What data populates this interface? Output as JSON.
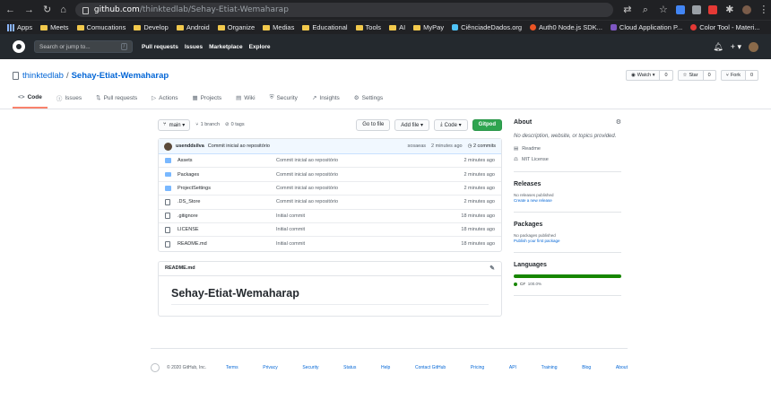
{
  "browser": {
    "url_host": "github.com",
    "url_path": "/thinktedlab/Sehay-Etiat-Wemaharap",
    "bookmarks": [
      "Apps",
      "Meets",
      "Comucations",
      "Develop",
      "Android",
      "Organize",
      "Medias",
      "Educational",
      "Tools",
      "AI",
      "MyPay",
      "CiênciadeDados.org",
      "Auth0 Node.js SDK...",
      "Cloud Application P...",
      "Color Tool - Materi..."
    ]
  },
  "gh_header": {
    "search_placeholder": "Search or jump to...",
    "search_key": "/",
    "nav": [
      "Pull requests",
      "Issues",
      "Marketplace",
      "Explore"
    ],
    "plus": "+ ▾"
  },
  "repo": {
    "owner": "thinktedlab",
    "separator": "/",
    "name": "Sehay-Etiat-Wemaharap",
    "watch_label": "Watch ▾",
    "watch_count": "0",
    "star_label": "Star",
    "star_count": "0",
    "fork_label": "Fork",
    "fork_count": "0",
    "tabs": [
      {
        "icon": "<>",
        "label": "Code"
      },
      {
        "icon": "ⓘ",
        "label": "Issues"
      },
      {
        "icon": "⇅",
        "label": "Pull requests"
      },
      {
        "icon": "▷",
        "label": "Actions"
      },
      {
        "icon": "▦",
        "label": "Projects"
      },
      {
        "icon": "▤",
        "label": "Wiki"
      },
      {
        "icon": "⛨",
        "label": "Security"
      },
      {
        "icon": "↗",
        "label": "Insights"
      },
      {
        "icon": "⚙",
        "label": "Settings"
      }
    ]
  },
  "toolbar": {
    "branch": "main ▾",
    "branches": "1 branch",
    "tags": "0 tags",
    "go_to_file": "Go to file",
    "add_file": "Add file ▾",
    "code": "Code ▾",
    "gitpod": "Gitpod"
  },
  "commit": {
    "author": "usenddsilva",
    "message": "Commit inicial ao repositório",
    "hash": "sosaeas",
    "time": "2 minutes ago",
    "count": "2 commits"
  },
  "files": [
    {
      "type": "dir",
      "name": "Assets",
      "message": "Commit inicial ao repositório",
      "time": "2 minutes ago"
    },
    {
      "type": "dir",
      "name": "Packages",
      "message": "Commit inicial ao repositório",
      "time": "2 minutes ago"
    },
    {
      "type": "dir",
      "name": "ProjectSettings",
      "message": "Commit inicial ao repositório",
      "time": "2 minutes ago"
    },
    {
      "type": "file",
      "name": ".DS_Store",
      "message": "Commit inicial ao repositório",
      "time": "2 minutes ago"
    },
    {
      "type": "file",
      "name": ".gitignore",
      "message": "Initial commit",
      "time": "18 minutes ago"
    },
    {
      "type": "file",
      "name": "LICENSE",
      "message": "Initial commit",
      "time": "18 minutes ago"
    },
    {
      "type": "file",
      "name": "README.md",
      "message": "Initial commit",
      "time": "18 minutes ago"
    }
  ],
  "readme": {
    "filename": "README.md",
    "heading": "Sehay-Etiat-Wemaharap"
  },
  "sidebar": {
    "about_title": "About",
    "description": "No description, website, or topics provided.",
    "readme_link": "Readme",
    "license_link": "MIT License",
    "releases_title": "Releases",
    "releases_empty": "No releases published",
    "releases_create": "Create a new release",
    "packages_title": "Packages",
    "packages_empty": "No packages published",
    "packages_publish": "Publish your first package",
    "languages_title": "Languages",
    "language_name": "C#",
    "language_pct": "100.0%",
    "language_color": "#178600"
  },
  "footer": {
    "copyright": "© 2020 GitHub, Inc.",
    "links": [
      "Terms",
      "Privacy",
      "Security",
      "Status",
      "Help",
      "Contact GitHub",
      "Pricing",
      "API",
      "Training",
      "Blog",
      "About"
    ]
  }
}
